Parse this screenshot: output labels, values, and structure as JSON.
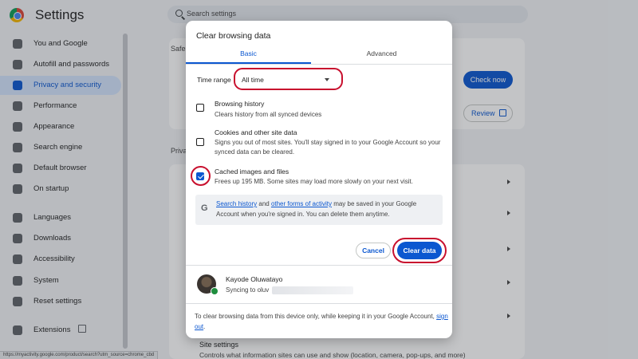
{
  "app": {
    "title": "Settings"
  },
  "search": {
    "placeholder": "Search settings"
  },
  "sidebar": {
    "items": [
      {
        "label": "You and Google",
        "icon": "person-icon"
      },
      {
        "label": "Autofill and passwords",
        "icon": "key-icon"
      },
      {
        "label": "Privacy and security",
        "icon": "shield-icon",
        "active": true
      },
      {
        "label": "Performance",
        "icon": "speedometer-icon"
      },
      {
        "label": "Appearance",
        "icon": "palette-icon"
      },
      {
        "label": "Search engine",
        "icon": "search-icon"
      },
      {
        "label": "Default browser",
        "icon": "browser-icon"
      },
      {
        "label": "On startup",
        "icon": "power-icon"
      },
      {
        "label": "Languages",
        "icon": "globe-icon"
      },
      {
        "label": "Downloads",
        "icon": "download-icon"
      },
      {
        "label": "Accessibility",
        "icon": "accessibility-icon"
      },
      {
        "label": "System",
        "icon": "wrench-icon"
      },
      {
        "label": "Reset settings",
        "icon": "reset-icon"
      },
      {
        "label": "Extensions",
        "icon": "puzzle-icon"
      }
    ]
  },
  "background": {
    "safety_check_label": "Safe",
    "privacy_label": "Priva",
    "check_now_label": "Check now",
    "review_label": "Review",
    "site_settings_title": "Site settings",
    "site_settings_desc": "Controls what information sites can use and show (location, camera, pop-ups, and more)"
  },
  "status_url": "https://myactivity.google.com/product/search?utm_source=chrome_cbd",
  "dialog": {
    "title": "Clear browsing data",
    "tabs": [
      "Basic",
      "Advanced"
    ],
    "active_tab": "Basic",
    "time_range": {
      "label": "Time range",
      "value": "All time"
    },
    "options": [
      {
        "title": "Browsing history",
        "desc": "Clears history from all synced devices",
        "checked": false
      },
      {
        "title": "Cookies and other site data",
        "desc": "Signs you out of most sites. You'll stay signed in to your Google Account so your synced data can be cleared.",
        "checked": false
      },
      {
        "title": "Cached images and files",
        "desc": "Frees up 195 MB. Some sites may load more slowly on your next visit.",
        "checked": true
      }
    ],
    "info": {
      "link1": "Search history",
      "text1": " and ",
      "link2": "other forms of activity",
      "text2": " may be saved in your Google Account when you're signed in. You can delete them anytime."
    },
    "cancel_label": "Cancel",
    "clear_label": "Clear data",
    "account": {
      "name": "Kayode Oluwatayo",
      "sync_prefix": "Syncing to oluv"
    },
    "footer": {
      "text": "To clear browsing data from this device only, while keeping it in your Google Account, ",
      "link": "sign out",
      "end": "."
    }
  },
  "colors": {
    "accent": "#0b57d0",
    "highlight": "#c8102e",
    "active_nav_bg": "#d3e3fd"
  }
}
